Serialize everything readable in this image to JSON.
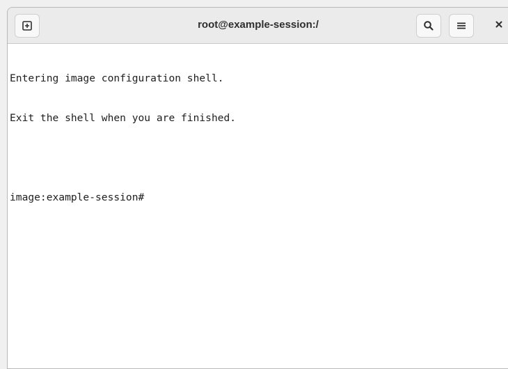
{
  "window": {
    "title": "root@example-session:/"
  },
  "headerbar": {
    "buttons": [
      {
        "name": "new-tab",
        "icon": "new-tab-icon"
      },
      {
        "name": "search",
        "icon": "search-icon"
      },
      {
        "name": "menu",
        "icon": "hamburger-menu-icon"
      },
      {
        "name": "close",
        "icon": "close-icon"
      }
    ]
  },
  "terminal": {
    "lines": [
      "Entering image configuration shell.",
      "Exit the shell when you are finished.",
      "",
      "image:example-session#"
    ]
  },
  "colors": {
    "headerbar_bg": "#ebebeb",
    "terminal_bg": "#ffffff",
    "text": "#1e1e1e"
  }
}
